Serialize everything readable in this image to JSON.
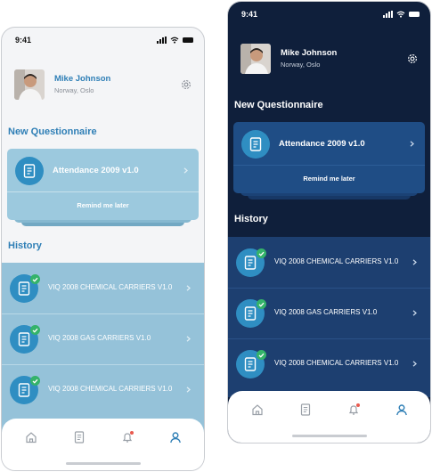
{
  "status": {
    "time": "9:41"
  },
  "profile": {
    "name": "Mike Johnson",
    "location": "Norway, Oslo"
  },
  "sections": {
    "new_questionnaire": "New Questionnaire",
    "history": "History"
  },
  "new_questionnaire": {
    "title": "Attendance 2009 v1.0",
    "remind": "Remind me later"
  },
  "history_light": [
    {
      "title": "VIQ 2008 CHEMICAL  CARRIERS V1.0"
    },
    {
      "title": "VIQ 2008 GAS CARRIERS V1.0"
    },
    {
      "title": "VIQ 2008 CHEMICAL  CARRIERS V1.0"
    }
  ],
  "history_dark": [
    {
      "title": "VIQ 2008 CHEMICAL  CARRIERS V1.0"
    },
    {
      "title": "VIQ 2008 GAS CARRIERS V1.0"
    },
    {
      "title": "VIQ 2008 CHEMICAL  CARRIERS V1.0"
    }
  ],
  "tabs": [
    {
      "icon": "home-icon"
    },
    {
      "icon": "document-icon"
    },
    {
      "icon": "bell-icon"
    },
    {
      "icon": "profile-icon"
    }
  ],
  "colors": {
    "light_accent": "#2f7fb6",
    "dark_background": "#0f1f3b",
    "dark_card": "#1f4d85",
    "check_green": "#34b36a",
    "active_tab": "#2f7fb6"
  }
}
